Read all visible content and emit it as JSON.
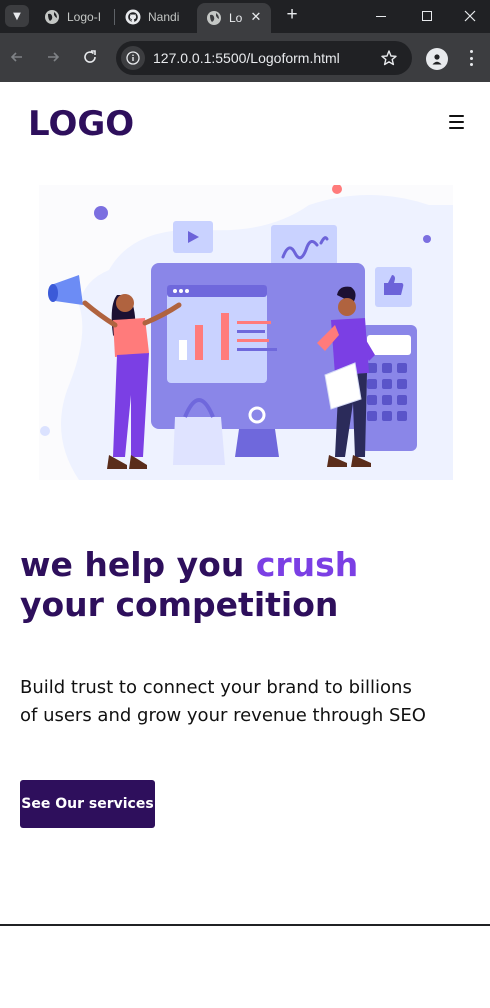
{
  "browser": {
    "tabs": [
      {
        "title": "Logo-I",
        "favicon": "globe-icon"
      },
      {
        "title": "Nandi",
        "favicon": "github-icon"
      },
      {
        "title": "Lo",
        "favicon": "globe-icon",
        "active": true
      }
    ],
    "new_tab_label": "+",
    "address": "127.0.0.1:5500/Logoform.html"
  },
  "header": {
    "logo": "LOGO",
    "menu_icon": "hamburger-icon"
  },
  "hero": {
    "illustration": "team-analytics-illustration",
    "headline_part1": "we help you ",
    "headline_accent": "crush",
    "headline_part2": " your competition",
    "subtext": "Build trust to connect your brand to billions of users and grow your revenue through SEO",
    "cta_label": "See Our services"
  },
  "colors": {
    "brand_dark": "#2e0f5c",
    "accent": "#7b3fe4",
    "button_bg": "#2e0f5c",
    "chrome_dark": "#202124",
    "chrome_toolbar": "#3c3d40"
  }
}
